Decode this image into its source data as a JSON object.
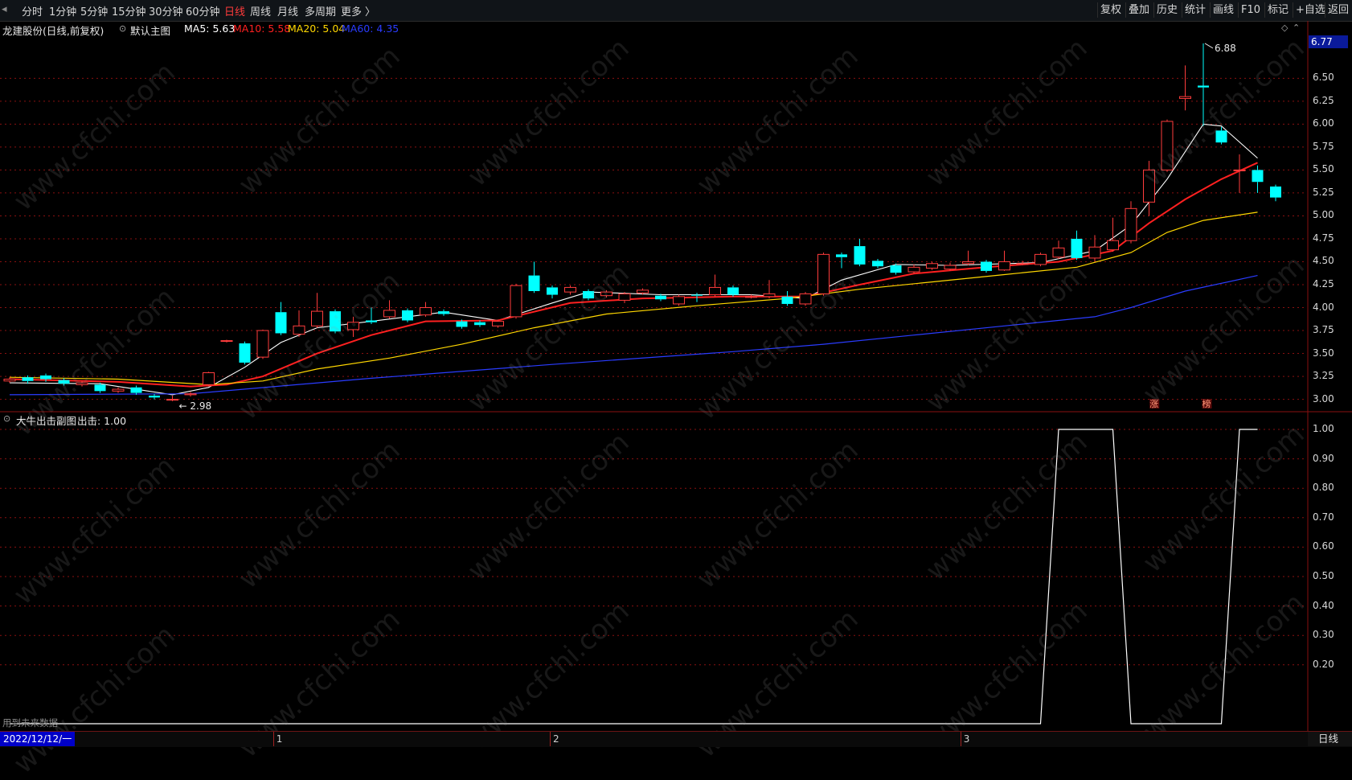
{
  "toolbar": {
    "periods": [
      "分时",
      "1分钟",
      "5分钟",
      "15分钟",
      "30分钟",
      "60分钟",
      "日线",
      "周线",
      "月线",
      "多周期",
      "更多"
    ],
    "active_period": "日线",
    "right_buttons": [
      "复权",
      "叠加",
      "历史",
      "统计",
      "画线",
      "F10",
      "标记",
      "+自选",
      "返回"
    ]
  },
  "main_chart": {
    "stock_label": "龙建股份(日线,前复权)",
    "template_label": "默认主图",
    "ma": [
      {
        "label": "MA5: 5.63",
        "color": "#ffffff"
      },
      {
        "label": "MA10: 5.58",
        "color": "#ff2020"
      },
      {
        "label": "MA20: 5.04",
        "color": "#ffd700"
      },
      {
        "label": "MA60: 4.35",
        "color": "#2a3cff"
      }
    ],
    "last_price": "6.77",
    "high_label": "6.88",
    "low_label": "2.98",
    "markers": [
      "涨",
      "榜"
    ]
  },
  "sub_chart": {
    "title": "大牛出击副图",
    "value_label": "出击: 1.00",
    "future_data_notice": "用到未来数据"
  },
  "bottom_bar": {
    "date_label": "2022/12/12/一",
    "month_ticks": [
      "1",
      "2",
      "3"
    ],
    "period_label": "日线"
  },
  "colors": {
    "up": "#ff3c3c",
    "down": "#00ffff",
    "ma5": "#ffffff",
    "ma10": "#ff2020",
    "ma20": "#ffd700",
    "ma60": "#2a3cff",
    "grid": "#8a1010"
  },
  "watermark": "www.cfchi.com",
  "chart_data": [
    {
      "type": "candlestick",
      "y_axis_ticks": [
        "6.50",
        "6.25",
        "6.00",
        "5.75",
        "5.50",
        "5.25",
        "5.00",
        "4.75",
        "4.50",
        "4.25",
        "4.00",
        "3.75",
        "3.50",
        "3.25",
        "3.00"
      ],
      "ylim": [
        2.9,
        6.95
      ],
      "candles": [
        {
          "o": 3.2,
          "c": 3.22,
          "h": 3.24,
          "l": 3.18
        },
        {
          "o": 3.24,
          "c": 3.2,
          "h": 3.26,
          "l": 3.17
        },
        {
          "o": 3.26,
          "c": 3.22,
          "h": 3.28,
          "l": 3.19
        },
        {
          "o": 3.21,
          "c": 3.17,
          "h": 3.23,
          "l": 3.15
        },
        {
          "o": 3.16,
          "c": 3.18,
          "h": 3.2,
          "l": 3.14
        },
        {
          "o": 3.16,
          "c": 3.09,
          "h": 3.18,
          "l": 3.07
        },
        {
          "o": 3.09,
          "c": 3.11,
          "h": 3.13,
          "l": 3.07
        },
        {
          "o": 3.13,
          "c": 3.07,
          "h": 3.15,
          "l": 3.05
        },
        {
          "o": 3.04,
          "c": 3.02,
          "h": 3.06,
          "l": 3.0
        },
        {
          "o": 3.0,
          "c": 3.0,
          "h": 3.04,
          "l": 2.98
        },
        {
          "o": 3.05,
          "c": 3.06,
          "h": 3.08,
          "l": 3.03
        },
        {
          "o": 3.16,
          "c": 3.29,
          "h": 3.3,
          "l": 3.14
        },
        {
          "o": 3.64,
          "c": 3.64,
          "h": 3.65,
          "l": 3.62
        },
        {
          "o": 3.61,
          "c": 3.4,
          "h": 3.63,
          "l": 3.38
        },
        {
          "o": 3.46,
          "c": 3.75,
          "h": 3.76,
          "l": 3.44
        },
        {
          "o": 3.95,
          "c": 3.72,
          "h": 4.06,
          "l": 3.7
        },
        {
          "o": 3.71,
          "c": 3.8,
          "h": 3.97,
          "l": 3.68
        },
        {
          "o": 3.8,
          "c": 3.96,
          "h": 4.16,
          "l": 3.78
        },
        {
          "o": 3.96,
          "c": 3.74,
          "h": 3.98,
          "l": 3.72
        },
        {
          "o": 3.76,
          "c": 3.84,
          "h": 3.9,
          "l": 3.68
        },
        {
          "o": 3.86,
          "c": 3.84,
          "h": 4.0,
          "l": 3.82
        },
        {
          "o": 3.9,
          "c": 3.97,
          "h": 4.08,
          "l": 3.88
        },
        {
          "o": 3.97,
          "c": 3.86,
          "h": 3.99,
          "l": 3.84
        },
        {
          "o": 3.92,
          "c": 4.0,
          "h": 4.06,
          "l": 3.9
        },
        {
          "o": 3.96,
          "c": 3.93,
          "h": 3.98,
          "l": 3.91
        },
        {
          "o": 3.85,
          "c": 3.79,
          "h": 3.87,
          "l": 3.77
        },
        {
          "o": 3.84,
          "c": 3.81,
          "h": 3.86,
          "l": 3.79
        },
        {
          "o": 3.8,
          "c": 3.85,
          "h": 3.87,
          "l": 3.78
        },
        {
          "o": 3.9,
          "c": 4.24,
          "h": 4.26,
          "l": 3.88
        },
        {
          "o": 4.35,
          "c": 4.18,
          "h": 4.5,
          "l": 4.16
        },
        {
          "o": 4.22,
          "c": 4.14,
          "h": 4.24,
          "l": 4.1
        },
        {
          "o": 4.17,
          "c": 4.22,
          "h": 4.24,
          "l": 4.14
        },
        {
          "o": 4.18,
          "c": 4.1,
          "h": 4.2,
          "l": 4.08
        },
        {
          "o": 4.13,
          "c": 4.17,
          "h": 4.19,
          "l": 4.11
        },
        {
          "o": 4.08,
          "c": 4.15,
          "h": 4.17,
          "l": 4.05
        },
        {
          "o": 4.16,
          "c": 4.19,
          "h": 4.21,
          "l": 4.14
        },
        {
          "o": 4.13,
          "c": 4.09,
          "h": 4.15,
          "l": 4.07
        },
        {
          "o": 4.04,
          "c": 4.12,
          "h": 4.14,
          "l": 4.02
        },
        {
          "o": 4.14,
          "c": 4.13,
          "h": 4.16,
          "l": 4.06
        },
        {
          "o": 4.14,
          "c": 4.22,
          "h": 4.36,
          "l": 4.12
        },
        {
          "o": 4.22,
          "c": 4.14,
          "h": 4.24,
          "l": 4.12
        },
        {
          "o": 4.12,
          "c": 4.12,
          "h": 4.14,
          "l": 4.1
        },
        {
          "o": 4.12,
          "c": 4.15,
          "h": 4.3,
          "l": 4.1
        },
        {
          "o": 4.12,
          "c": 4.04,
          "h": 4.18,
          "l": 4.02
        },
        {
          "o": 4.04,
          "c": 4.15,
          "h": 4.17,
          "l": 4.02
        },
        {
          "o": 4.15,
          "c": 4.58,
          "h": 4.6,
          "l": 4.13
        },
        {
          "o": 4.58,
          "c": 4.55,
          "h": 4.6,
          "l": 4.43
        },
        {
          "o": 4.67,
          "c": 4.47,
          "h": 4.75,
          "l": 4.45
        },
        {
          "o": 4.51,
          "c": 4.45,
          "h": 4.53,
          "l": 4.43
        },
        {
          "o": 4.46,
          "c": 4.38,
          "h": 4.48,
          "l": 4.36
        },
        {
          "o": 4.39,
          "c": 4.44,
          "h": 4.47,
          "l": 4.37
        },
        {
          "o": 4.43,
          "c": 4.48,
          "h": 4.5,
          "l": 4.41
        },
        {
          "o": 4.42,
          "c": 4.46,
          "h": 4.49,
          "l": 4.4
        },
        {
          "o": 4.48,
          "c": 4.5,
          "h": 4.62,
          "l": 4.46
        },
        {
          "o": 4.5,
          "c": 4.4,
          "h": 4.52,
          "l": 4.38
        },
        {
          "o": 4.41,
          "c": 4.5,
          "h": 4.62,
          "l": 4.4
        },
        {
          "o": 4.48,
          "c": 4.48,
          "h": 4.51,
          "l": 4.46
        },
        {
          "o": 4.47,
          "c": 4.58,
          "h": 4.6,
          "l": 4.45
        },
        {
          "o": 4.55,
          "c": 4.65,
          "h": 4.73,
          "l": 4.53
        },
        {
          "o": 4.75,
          "c": 4.54,
          "h": 4.84,
          "l": 4.52
        },
        {
          "o": 4.54,
          "c": 4.66,
          "h": 4.79,
          "l": 4.5
        },
        {
          "o": 4.63,
          "c": 4.73,
          "h": 4.98,
          "l": 4.61
        },
        {
          "o": 4.73,
          "c": 5.08,
          "h": 5.16,
          "l": 4.7
        },
        {
          "o": 5.15,
          "c": 5.5,
          "h": 5.6,
          "l": 5.0
        },
        {
          "o": 5.5,
          "c": 6.03,
          "h": 6.05,
          "l": 5.48
        },
        {
          "o": 6.28,
          "c": 6.3,
          "h": 6.64,
          "l": 6.15
        },
        {
          "o": 6.42,
          "c": 6.4,
          "h": 6.88,
          "l": 5.98
        },
        {
          "o": 5.93,
          "c": 5.8,
          "h": 5.97,
          "l": 5.78
        },
        {
          "o": 5.5,
          "c": 5.5,
          "h": 5.67,
          "l": 5.25
        },
        {
          "o": 5.5,
          "c": 5.37,
          "h": 5.55,
          "l": 5.25
        },
        {
          "o": 5.32,
          "c": 5.2,
          "h": 5.34,
          "l": 5.16
        }
      ],
      "series": [
        {
          "name": "MA5",
          "points": [
            [
              0,
              3.18
            ],
            [
              5,
              3.17
            ],
            [
              9,
              3.05
            ],
            [
              11,
              3.13
            ],
            [
              13,
              3.35
            ],
            [
              15,
              3.62
            ],
            [
              17,
              3.78
            ],
            [
              20,
              3.85
            ],
            [
              24,
              3.95
            ],
            [
              27,
              3.86
            ],
            [
              30,
              4.05
            ],
            [
              32,
              4.17
            ],
            [
              36,
              4.14
            ],
            [
              41,
              4.14
            ],
            [
              44,
              4.1
            ],
            [
              46,
              4.3
            ],
            [
              49,
              4.47
            ],
            [
              52,
              4.46
            ],
            [
              57,
              4.49
            ],
            [
              60,
              4.62
            ],
            [
              62,
              4.9
            ],
            [
              64,
              5.4
            ],
            [
              66,
              6.0
            ],
            [
              67,
              5.98
            ],
            [
              69,
              5.63
            ]
          ]
        },
        {
          "name": "MA10",
          "points": [
            [
              0,
              3.22
            ],
            [
              6,
              3.19
            ],
            [
              10,
              3.14
            ],
            [
              12,
              3.16
            ],
            [
              14,
              3.25
            ],
            [
              17,
              3.5
            ],
            [
              20,
              3.7
            ],
            [
              23,
              3.85
            ],
            [
              27,
              3.86
            ],
            [
              31,
              4.05
            ],
            [
              35,
              4.1
            ],
            [
              40,
              4.12
            ],
            [
              44,
              4.12
            ],
            [
              47,
              4.25
            ],
            [
              50,
              4.37
            ],
            [
              54,
              4.44
            ],
            [
              58,
              4.5
            ],
            [
              61,
              4.62
            ],
            [
              63,
              4.92
            ],
            [
              65,
              5.18
            ],
            [
              67,
              5.4
            ],
            [
              69,
              5.58
            ]
          ]
        },
        {
          "name": "MA20",
          "points": [
            [
              0,
              3.24
            ],
            [
              6,
              3.22
            ],
            [
              11,
              3.16
            ],
            [
              14,
              3.2
            ],
            [
              17,
              3.33
            ],
            [
              21,
              3.45
            ],
            [
              25,
              3.6
            ],
            [
              29,
              3.78
            ],
            [
              33,
              3.93
            ],
            [
              38,
              4.02
            ],
            [
              43,
              4.1
            ],
            [
              47,
              4.2
            ],
            [
              51,
              4.28
            ],
            [
              55,
              4.36
            ],
            [
              59,
              4.44
            ],
            [
              62,
              4.6
            ],
            [
              64,
              4.82
            ],
            [
              66,
              4.95
            ],
            [
              69,
              5.04
            ]
          ]
        },
        {
          "name": "MA60",
          "points": [
            [
              0,
              3.05
            ],
            [
              10,
              3.06
            ],
            [
              20,
              3.23
            ],
            [
              30,
              3.38
            ],
            [
              40,
              3.52
            ],
            [
              45,
              3.6
            ],
            [
              50,
              3.7
            ],
            [
              55,
              3.8
            ],
            [
              60,
              3.9
            ],
            [
              62,
              4.0
            ],
            [
              65,
              4.18
            ],
            [
              69,
              4.35
            ]
          ]
        }
      ]
    },
    {
      "type": "line",
      "title": "大牛出击副图",
      "y_axis_ticks": [
        "1.00",
        "0.90",
        "0.80",
        "0.70",
        "0.60",
        "0.50",
        "0.40",
        "0.30",
        "0.20"
      ],
      "ylim": [
        0,
        1.0
      ],
      "series": [
        {
          "name": "出击",
          "points": [
            [
              0,
              0
            ],
            [
              57,
              0
            ],
            [
              58,
              1
            ],
            [
              61,
              1
            ],
            [
              62,
              0
            ],
            [
              67,
              0
            ],
            [
              68,
              1
            ],
            [
              69,
              1
            ]
          ]
        }
      ]
    }
  ]
}
